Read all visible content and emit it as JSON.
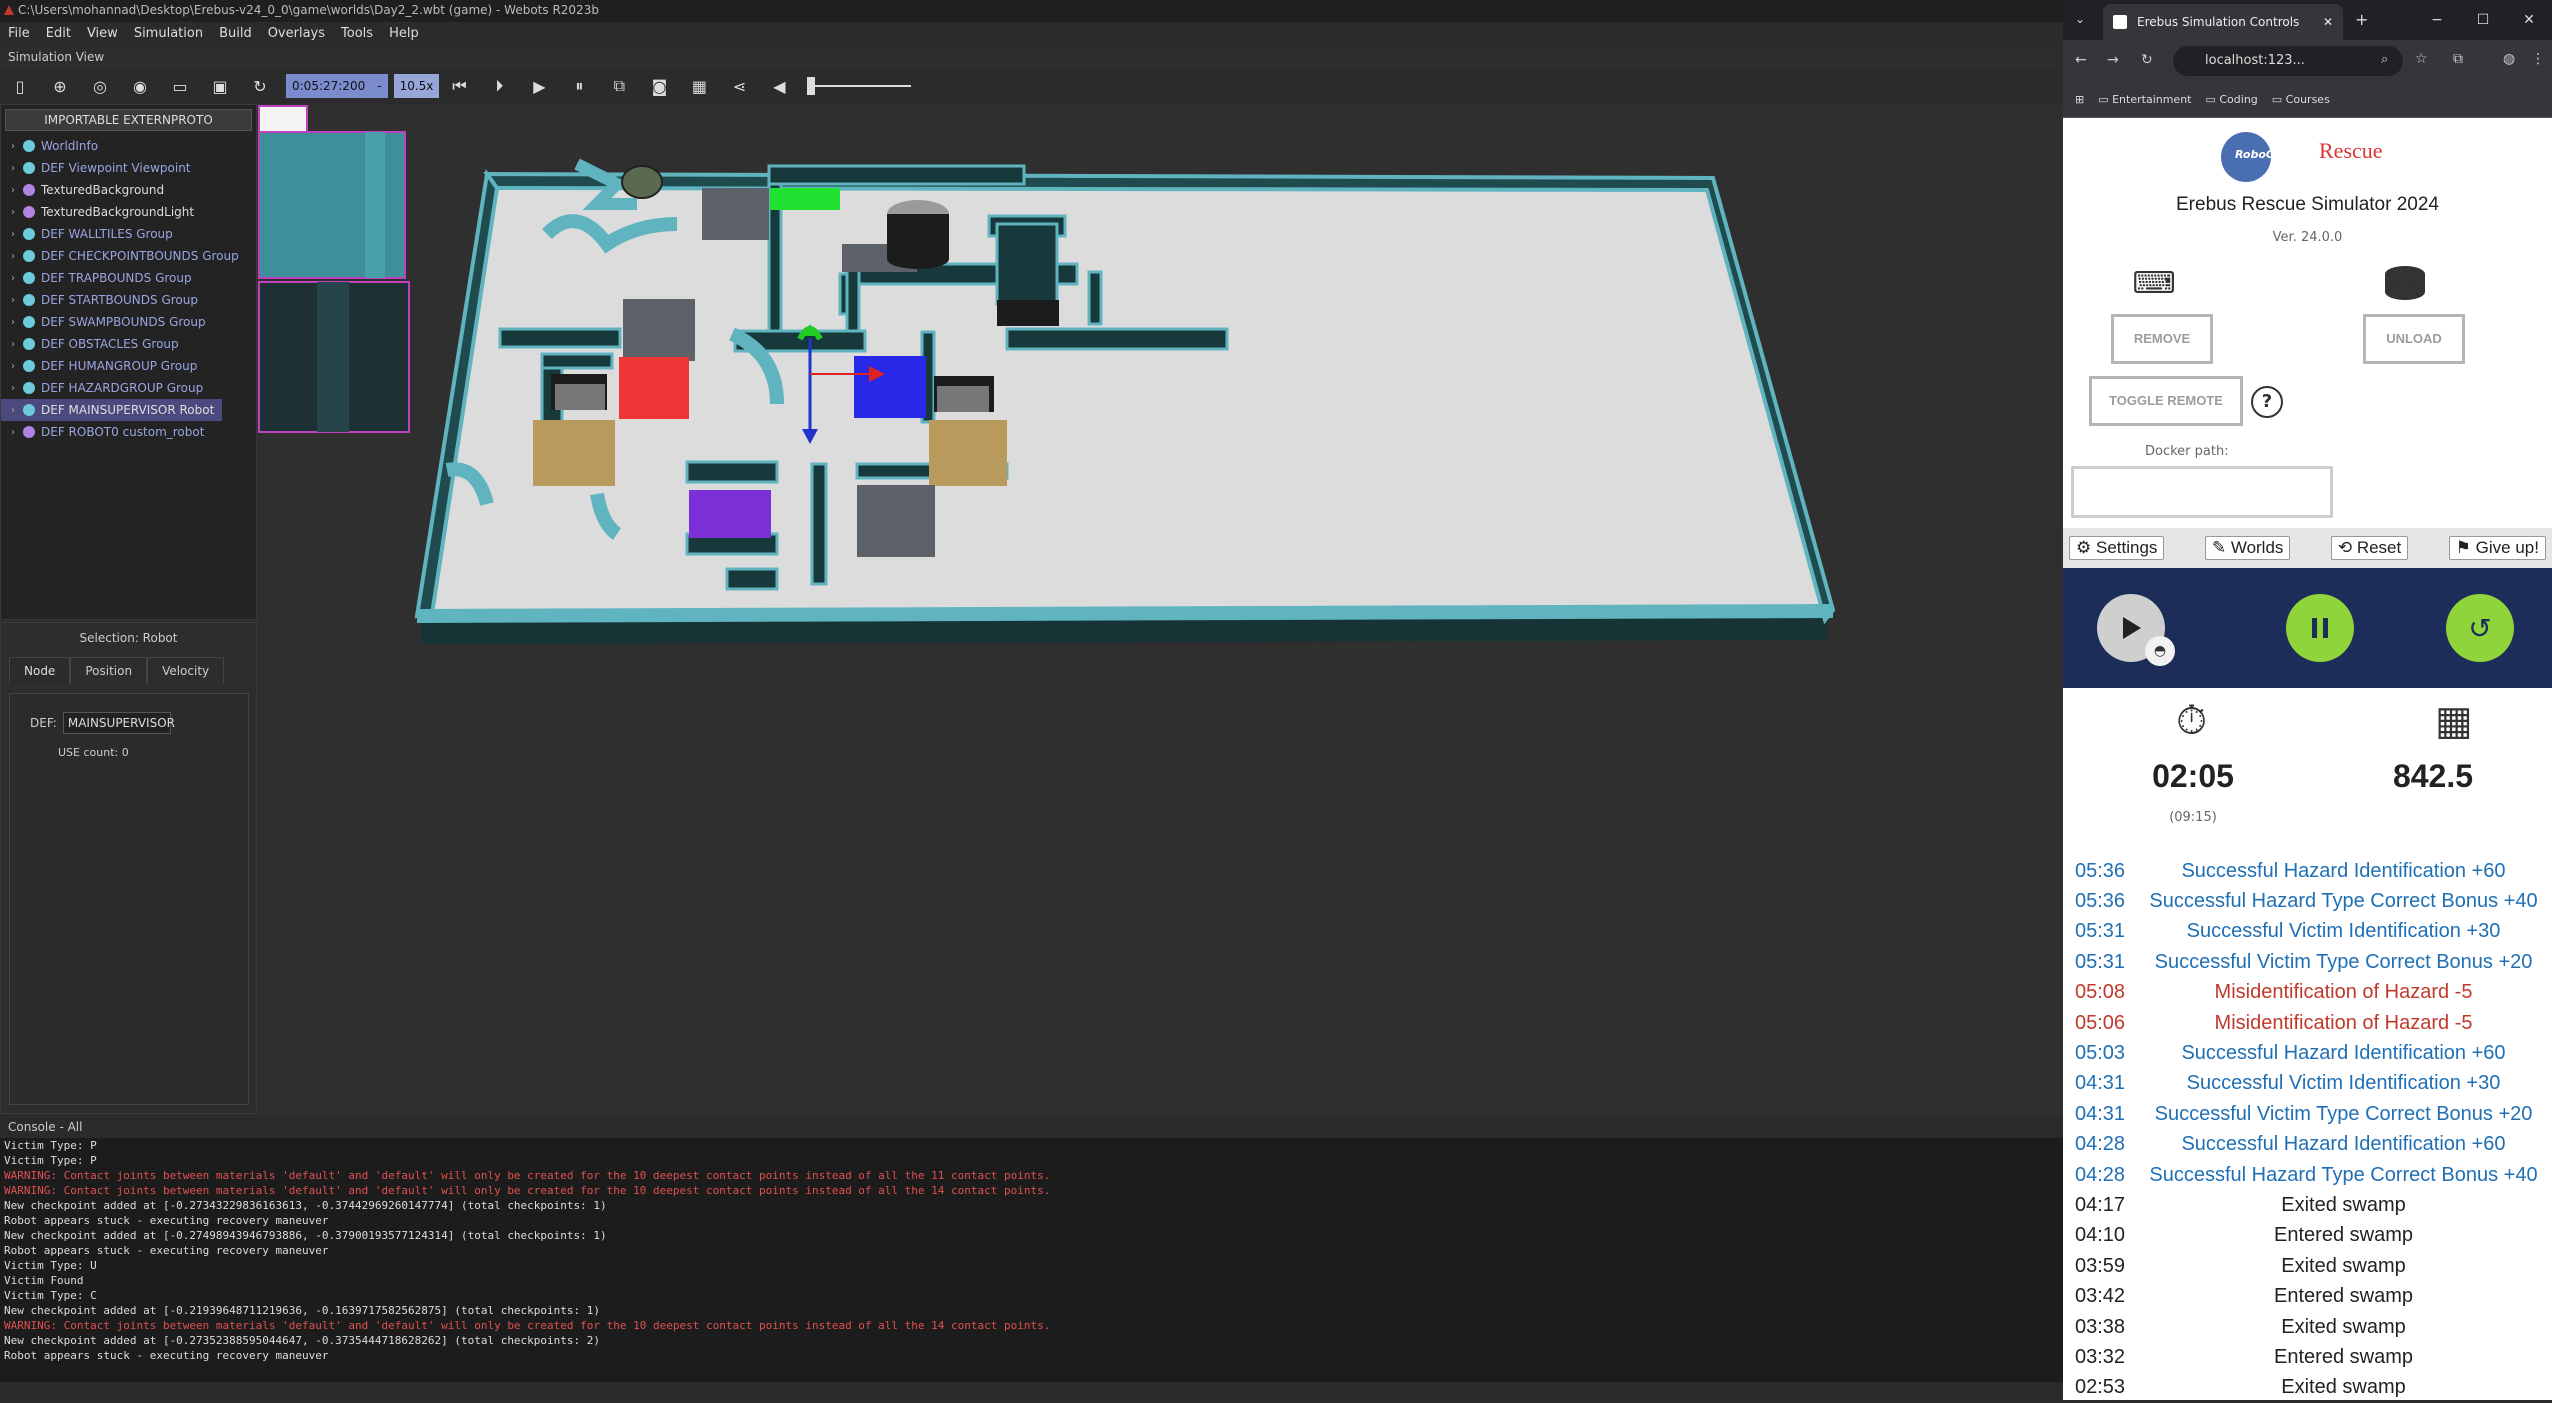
{
  "webots": {
    "title": "C:\\Users\\mohannad\\Desktop\\Erebus-v24_0_0\\game\\worlds\\Day2_2.wbt (game) - Webots R2023b",
    "menu": [
      "File",
      "Edit",
      "View",
      "Simulation",
      "Build",
      "Overlays",
      "Tools",
      "Help"
    ],
    "sim_view_label": "Simulation View",
    "sim_time": "0:05:27:200",
    "speed": "10.5x",
    "extern_proto_button": "IMPORTABLE EXTERNPROTO",
    "tree": [
      {
        "label": "WorldInfo",
        "dot": "#6ccbd8",
        "style": "blue"
      },
      {
        "label": "DEF Viewpoint Viewpoint",
        "dot": "#6ccbd8",
        "style": "blue"
      },
      {
        "label": "TexturedBackground",
        "dot": "#b084e0",
        "style": "white"
      },
      {
        "label": "TexturedBackgroundLight",
        "dot": "#b084e0",
        "style": "white"
      },
      {
        "label": "DEF WALLTILES Group",
        "dot": "#6ccbd8",
        "style": "blue"
      },
      {
        "label": "DEF CHECKPOINTBOUNDS Group",
        "dot": "#6ccbd8",
        "style": "blue"
      },
      {
        "label": "DEF TRAPBOUNDS Group",
        "dot": "#6ccbd8",
        "style": "blue"
      },
      {
        "label": "DEF STARTBOUNDS Group",
        "dot": "#6ccbd8",
        "style": "blue"
      },
      {
        "label": "DEF SWAMPBOUNDS Group",
        "dot": "#6ccbd8",
        "style": "blue"
      },
      {
        "label": "DEF OBSTACLES Group",
        "dot": "#6ccbd8",
        "style": "blue"
      },
      {
        "label": "DEF HUMANGROUP Group",
        "dot": "#6ccbd8",
        "style": "blue"
      },
      {
        "label": "DEF HAZARDGROUP Group",
        "dot": "#6ccbd8",
        "style": "blue"
      },
      {
        "label": "DEF MAINSUPERVISOR Robot",
        "dot": "#6ccbd8",
        "style": "sel"
      },
      {
        "label": "DEF ROBOT0 custom_robot",
        "dot": "#b084e0",
        "style": "blue"
      }
    ],
    "selection_title": "Selection: Robot",
    "tabs": [
      "Node",
      "Position",
      "Velocity"
    ],
    "def_label": "DEF:",
    "def_value": "MAINSUPERVISOR",
    "use_count": "USE count: 0",
    "console_label": "Console - All",
    "console": [
      {
        "t": "Victim Type: P",
        "w": false
      },
      {
        "t": "Victim Type: P",
        "w": false
      },
      {
        "t": "WARNING: Contact joints between materials 'default' and 'default' will only be created for the 10 deepest contact points instead of all the 11 contact points.",
        "w": true
      },
      {
        "t": "WARNING: Contact joints between materials 'default' and 'default' will only be created for the 10 deepest contact points instead of all the 14 contact points.",
        "w": true
      },
      {
        "t": "New checkpoint added at [-0.27343229836163613, -0.37442969260147774] (total checkpoints: 1)",
        "w": false
      },
      {
        "t": "Robot appears stuck - executing recovery maneuver",
        "w": false
      },
      {
        "t": "New checkpoint added at [-0.27498943946793886, -0.37900193577124314] (total checkpoints: 1)",
        "w": false
      },
      {
        "t": "Robot appears stuck - executing recovery maneuver",
        "w": false
      },
      {
        "t": "Victim Type: U",
        "w": false
      },
      {
        "t": "Victim Found",
        "w": false
      },
      {
        "t": "Victim Type: C",
        "w": false
      },
      {
        "t": "New checkpoint added at [-0.21939648711219636, -0.1639717582562875] (total checkpoints: 1)",
        "w": false
      },
      {
        "t": "WARNING: Contact joints between materials 'default' and 'default' will only be created for the 10 deepest contact points instead of all the 14 contact points.",
        "w": true
      },
      {
        "t": "New checkpoint added at [-0.27352388595044647, -0.3735444718628262] (total checkpoints: 2)",
        "w": false
      },
      {
        "t": "Robot appears stuck - executing recovery maneuver",
        "w": false
      }
    ]
  },
  "browser": {
    "tab_title": "Erebus Simulation Controls",
    "url": "localhost:123...",
    "bookmarks": [
      "Entertainment",
      "Coding",
      "Courses"
    ],
    "logo_left": "RoboCup Junior",
    "logo_right": "Rescue",
    "app_title": "Erebus Rescue Simulator 2024",
    "version": "Ver. 24.0.0",
    "remove_label": "REMOVE",
    "unload_label": "UNLOAD",
    "toggle_remote_label": "TOGGLE REMOTE",
    "help_label": "?",
    "docker_label": "Docker path:",
    "docker_value": "",
    "nav": [
      "Settings",
      "Worlds",
      "Reset",
      "Give up!"
    ],
    "timer": "02:05",
    "timer_sub": "(09:15)",
    "score": "842.5",
    "log": [
      {
        "time": "05:36",
        "msg": "Successful Hazard Identification +60",
        "c": "blue"
      },
      {
        "time": "05:36",
        "msg": "Successful Hazard Type Correct Bonus +40",
        "c": "blue"
      },
      {
        "time": "05:31",
        "msg": "Successful Victim Identification +30",
        "c": "blue"
      },
      {
        "time": "05:31",
        "msg": "Successful Victim Type Correct Bonus +20",
        "c": "blue"
      },
      {
        "time": "05:08",
        "msg": "Misidentification of Hazard -5",
        "c": "red"
      },
      {
        "time": "05:06",
        "msg": "Misidentification of Hazard -5",
        "c": "red"
      },
      {
        "time": "05:03",
        "msg": "Successful Hazard Identification +60",
        "c": "blue"
      },
      {
        "time": "04:31",
        "msg": "Successful Victim Identification +30",
        "c": "blue"
      },
      {
        "time": "04:31",
        "msg": "Successful Victim Type Correct Bonus +20",
        "c": "blue"
      },
      {
        "time": "04:28",
        "msg": "Successful Hazard Identification +60",
        "c": "blue"
      },
      {
        "time": "04:28",
        "msg": "Successful Hazard Type Correct Bonus +40",
        "c": "blue"
      },
      {
        "time": "04:17",
        "msg": "Exited swamp",
        "c": "black"
      },
      {
        "time": "04:10",
        "msg": "Entered swamp",
        "c": "black"
      },
      {
        "time": "03:59",
        "msg": "Exited swamp",
        "c": "black"
      },
      {
        "time": "03:42",
        "msg": "Entered swamp",
        "c": "black"
      },
      {
        "time": "03:38",
        "msg": "Exited swamp",
        "c": "black"
      },
      {
        "time": "03:32",
        "msg": "Entered swamp",
        "c": "black"
      },
      {
        "time": "02:53",
        "msg": "Exited swamp",
        "c": "black"
      }
    ],
    "colors": {
      "blue": "#1f6fb5",
      "red": "#c0392b",
      "green": "#8fd43a",
      "navy": "#1b2d58"
    }
  }
}
